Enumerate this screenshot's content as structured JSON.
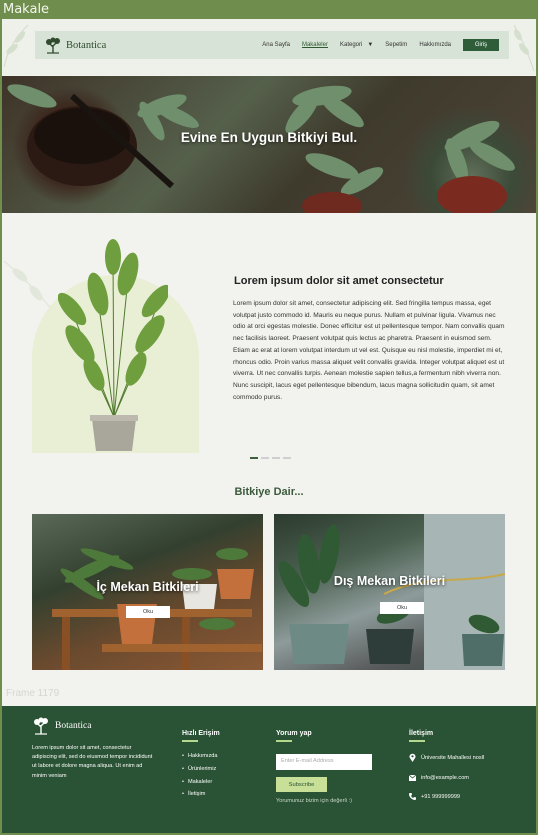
{
  "frame_label": "Makale",
  "brand": {
    "name": "Botantica",
    "accent": "#2f5d3a",
    "footer_bg": "#2a5234",
    "button_light": "#c7df97"
  },
  "nav": {
    "items": [
      "Ana Sayfa",
      "Makaleler",
      "Kategori",
      "Sepetim",
      "Hakkımızda"
    ],
    "active": "Makaleler",
    "login_label": "Giriş"
  },
  "hero": {
    "title": "Evine En Uygun Bitkiyi Bul."
  },
  "about": {
    "title": "Lorem ipsum dolor sit amet consectetur",
    "body": "Lorem ipsum dolor sit amet, consectetur adipiscing elit. Sed fringilla tempus massa, eget volutpat justo commodo id. Mauris eu neque purus. Nullam et pulvinar ligula. Vivamus nec odio at orci egestas molestie. Donec efficitur est ut pellentesque tempor. Nam convallis quam nec facilisis laoreet. Praesent volutpat quis lectus ac pharetra. Praesent in euismod sem. Etiam ac erat at lorem volutpat interdum ut vel est. Quisque eu nisl molestie, imperdiet mi et, rhoncus odio. Proin varius massa aliquet velit convallis gravida. Integer volutpat aliquet est ut viverra. Ut nec convallis turpis. Aenean molestie sapien tellus,a fermentum nibh viverra non. Nunc suscipit, lacus eget pellentesque bibendum, lacus magna sollicitudin quam, sit amet commodo purus."
  },
  "section": {
    "title": "Bitkiye Dair..."
  },
  "cards": [
    {
      "title": "İç Mekan Bitkileri",
      "button": "Oku"
    },
    {
      "title": "Dış Mekan Bitkileri",
      "button": "Oku"
    }
  ],
  "ghost_text": "Frame 1179",
  "footer": {
    "description": "Lorem ipsum dolor sit amet, consectetur adipiscing elit, sed do eiusmod tempor incididunt ut labore et dolore magna aliqua. Ut enim ad minim veniam",
    "quick_links": {
      "title": "Hızlı Erişim",
      "items": [
        "Hakkımızda",
        "Ürünlerimiz",
        "Makaleler",
        "İletişim"
      ]
    },
    "review": {
      "title": "Yorum yap",
      "placeholder": "Enter E-mail Address",
      "button": "Subscribe",
      "note": "Yorumunuz bizim için değerli :)"
    },
    "contact": {
      "title": "İletişim",
      "address": "Üniversite Mahallesi nosll",
      "email": "info@example.com",
      "phone": "+91 999999999"
    }
  }
}
